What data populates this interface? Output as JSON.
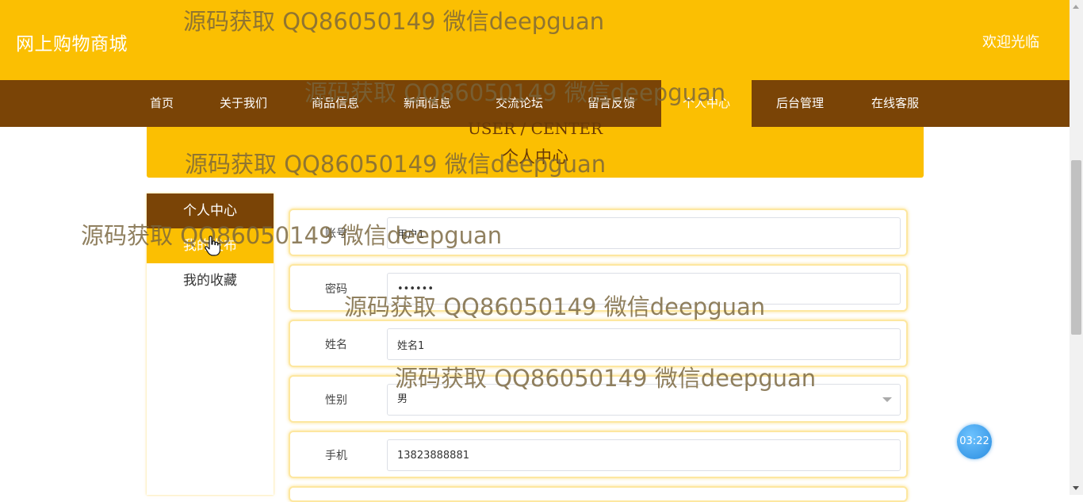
{
  "header": {
    "site_title": "网上购物商城",
    "welcome": "欢迎光临"
  },
  "nav": {
    "items": [
      "首页",
      "关于我们",
      "商品信息",
      "新闻信息",
      "交流论坛",
      "留言反馈",
      "个人中心",
      "后台管理",
      "在线客服"
    ],
    "active": "个人中心"
  },
  "banner": {
    "en": "USER / CENTER",
    "cn": "个人中心"
  },
  "sidebar": {
    "items": [
      "个人中心",
      "我的发布",
      "我的收藏"
    ]
  },
  "form": {
    "account": {
      "label": "账号",
      "value": "用户1"
    },
    "password": {
      "label": "密码",
      "value": "••••••"
    },
    "name": {
      "label": "姓名",
      "value": "姓名1"
    },
    "gender": {
      "label": "性别",
      "value": "男"
    },
    "phone": {
      "label": "手机",
      "value": "13823888881"
    }
  },
  "timer": "03:22",
  "watermark": "源码获取 QQ86050149 微信deepguan",
  "colors": {
    "accent": "#fbbf02",
    "nav_bg": "#7a4406",
    "timer": "#2a8de0"
  }
}
